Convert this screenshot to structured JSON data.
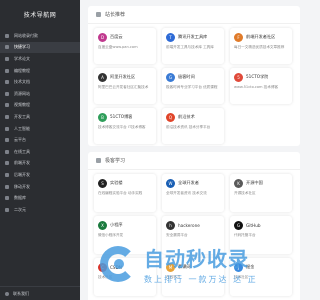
{
  "sidebar": {
    "title": "技术导航网",
    "items": [
      {
        "label": "网站收录付款"
      },
      {
        "label": "快捷学习"
      },
      {
        "label": "学术论文"
      },
      {
        "label": "编程教程"
      },
      {
        "label": "技术文档"
      },
      {
        "label": "资源网站"
      },
      {
        "label": "视频教程"
      },
      {
        "label": "开发工具"
      },
      {
        "label": "人工智能"
      },
      {
        "label": "云平台"
      },
      {
        "label": "在线工具"
      },
      {
        "label": "前端开发"
      },
      {
        "label": "后端开发"
      },
      {
        "label": "移动开发"
      },
      {
        "label": "数据库"
      },
      {
        "label": "二次元"
      }
    ],
    "footer": "联系我们"
  },
  "panels": [
    {
      "title": "站长推荐",
      "cards": [
        {
          "name": "百度云",
          "desc": "百度云盘www.pan.com",
          "color": "#c0398e",
          "icon": "D"
        },
        {
          "name": "腾讯开发工具库",
          "desc": "前端开发工具与技术库 工具库",
          "color": "#2e6bd6",
          "icon": "T"
        },
        {
          "name": "前端开发者社区",
          "desc": "每日一文精选优质技术文章推荐",
          "color": "#e07b2a",
          "icon": "F"
        },
        {
          "name": "阿里开发社区",
          "desc": "阿里巴巴云开发者社区汇聚技术",
          "color": "#333333",
          "icon": "A"
        },
        {
          "name": "极客时间",
          "desc": "极客时间专业学习平台 优质课程",
          "color": "#3a7bd5",
          "icon": "G"
        },
        {
          "name": "51CTO学院",
          "desc": "www.51cto.com 技术博客",
          "color": "#e04a3a",
          "icon": "5"
        },
        {
          "name": "51CTO博客",
          "desc": "技术博客交流平台 IT技术博客",
          "color": "#2f9e5a",
          "icon": "B"
        },
        {
          "name": "前沿技术",
          "desc": "前沿技术资讯 技术分享平台",
          "color": "#e0452a",
          "icon": "Q"
        }
      ]
    },
    {
      "title": "极客学习",
      "cards": [
        {
          "name": "实验楼",
          "desc": "在线编程实验平台 动手实践",
          "color": "#222222",
          "icon": "S"
        },
        {
          "name": "全球开发者",
          "desc": "全球开发者资讯 技术交流",
          "color": "#1a5fb4",
          "icon": "W"
        },
        {
          "name": "开源中国",
          "desc": "开源技术社区",
          "color": "#5a5a5a",
          "icon": "K"
        },
        {
          "name": "小程序",
          "desc": "微信小程序开发",
          "color": "#1b7a3e",
          "icon": "X"
        },
        {
          "name": "hackerone",
          "desc": "安全漏洞平台",
          "color": "#333333",
          "icon": "h"
        },
        {
          "name": "GitHub",
          "desc": "代码托管平台",
          "color": "#111111",
          "icon": "G"
        },
        {
          "name": "CSDN",
          "desc": "技术社区",
          "color": "#d9342b",
          "icon": "C"
        },
        {
          "name": "慕课网",
          "desc": "在线学习",
          "color": "#e8a33a",
          "icon": "M"
        },
        {
          "name": "掘金",
          "desc": "技术社区",
          "color": "#3a8be0",
          "icon": "J"
        }
      ]
    }
  ],
  "watermark": {
    "title": "自动秒收录",
    "subtitle": "数上排行 一款万达 达 正"
  }
}
